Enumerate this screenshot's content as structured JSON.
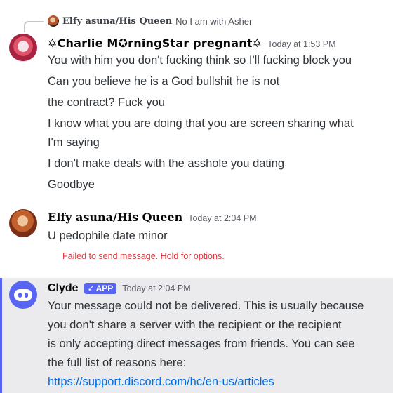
{
  "reply_preview": {
    "author": "Elfy asuna/His Queen",
    "text": "No I am with Asher"
  },
  "messages": [
    {
      "author": "✡Charlie M✪rningStar pregnant✡",
      "timestamp": "Today at 1:53 PM",
      "lines": [
        "You with him you don't fucking think so I'll fucking block you",
        "Can you believe he is a God bullshit he is not",
        "the contract?  Fuck you",
        "I know what you are doing that you are screen sharing what",
        "I'm saying",
        "I don't make deals with the asshole you dating",
        "Goodbye"
      ]
    },
    {
      "author": "Elfy asuna/His Queen",
      "timestamp": "Today at 2:04 PM",
      "lines": [
        "U pedophile date minor"
      ],
      "error": "Failed to send message. Hold for options."
    },
    {
      "author": "Clyde",
      "badge": "APP",
      "timestamp": "Today at 2:04 PM",
      "lines": [
        "Your message could not be delivered. This is usually because",
        "you don't share a server with the recipient or the recipient",
        "is only accepting direct messages from friends. You can see",
        "the full list of reasons here:"
      ],
      "link": "https://support.discord.com/hc/en-us/articles"
    }
  ],
  "colors": {
    "accent": "#5865f2",
    "error": "#da373c",
    "link": "#006ce7",
    "highlight_bg": "#ebebed"
  }
}
